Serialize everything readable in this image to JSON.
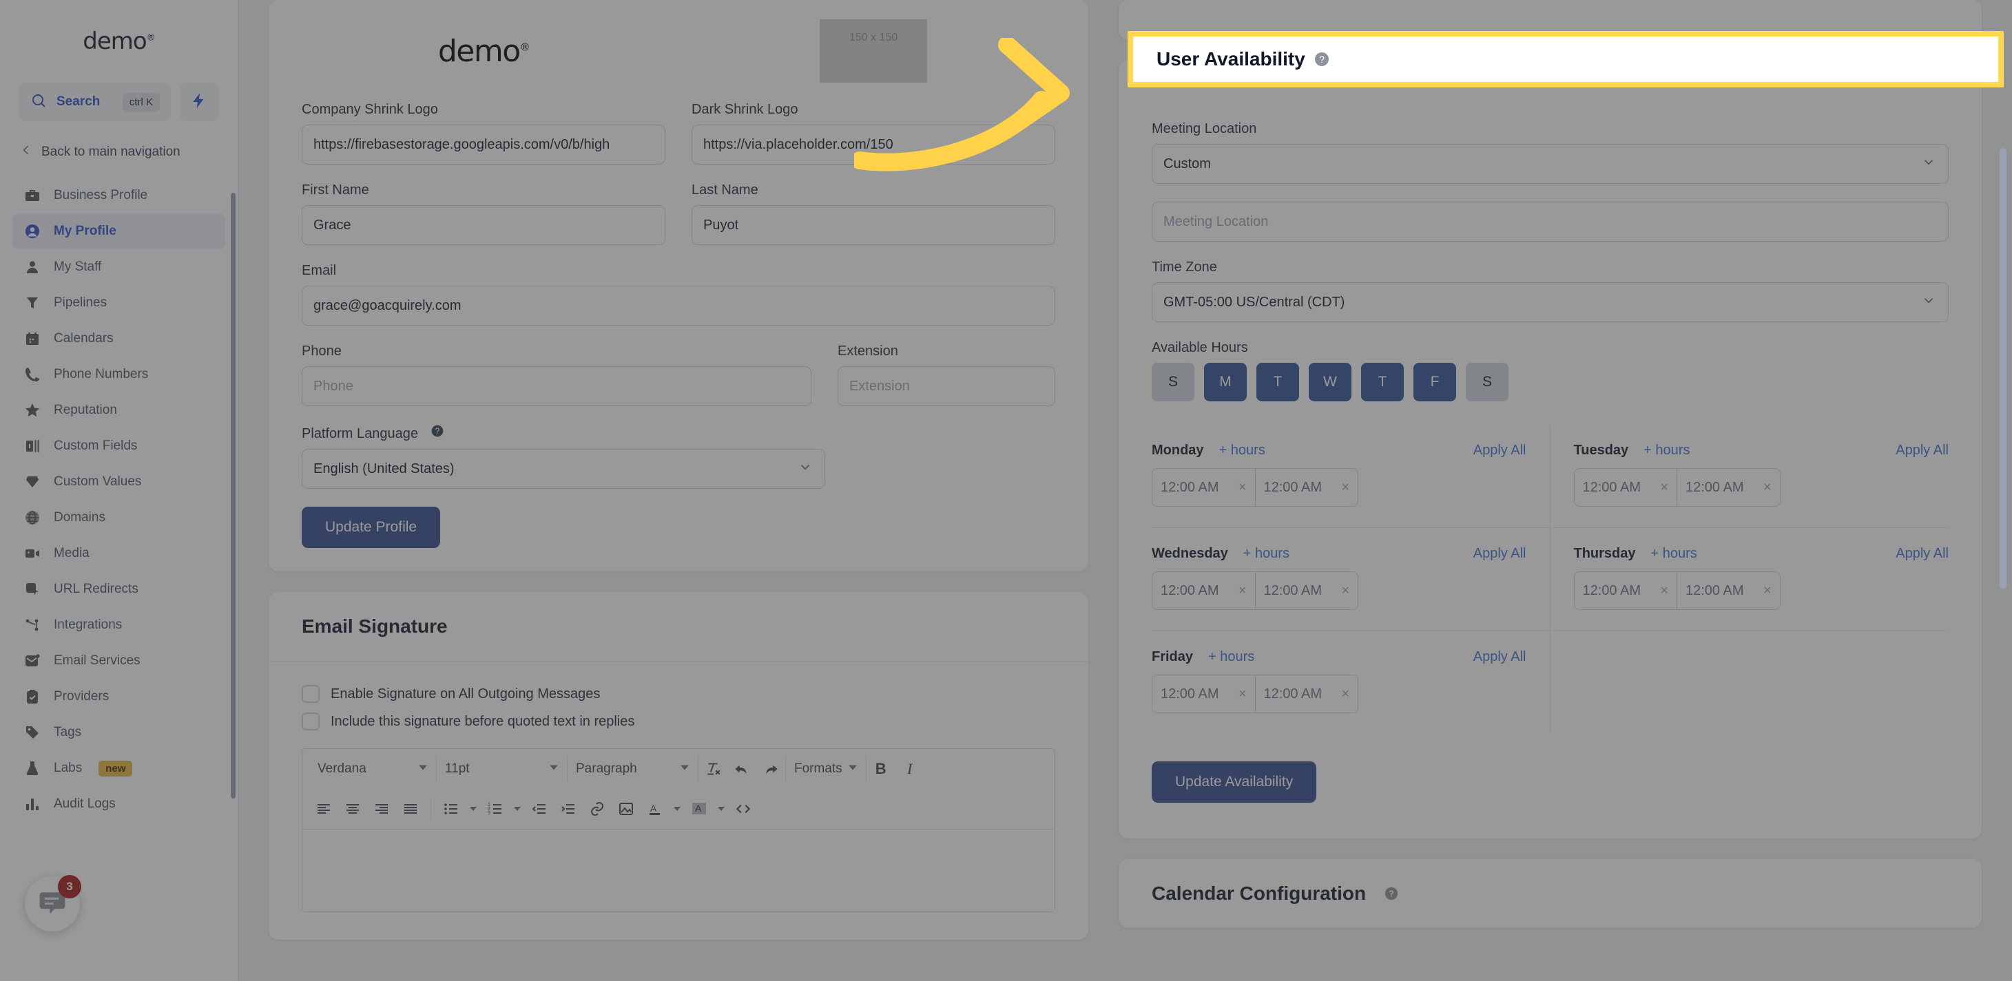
{
  "brand": {
    "name": "demo",
    "mark": "®"
  },
  "search": {
    "label": "Search",
    "shortcut": "ctrl K"
  },
  "back_nav": {
    "label": "Back to main navigation"
  },
  "sidebar": {
    "items": [
      {
        "label": "Business Profile",
        "icon": "briefcase-icon",
        "active": false
      },
      {
        "label": "My Profile",
        "icon": "user-circle-icon",
        "active": true
      },
      {
        "label": "My Staff",
        "icon": "person-icon",
        "active": false
      },
      {
        "label": "Pipelines",
        "icon": "funnel-icon",
        "active": false
      },
      {
        "label": "Calendars",
        "icon": "calendar-icon",
        "active": false
      },
      {
        "label": "Phone Numbers",
        "icon": "phone-icon",
        "active": false
      },
      {
        "label": "Reputation",
        "icon": "star-icon",
        "active": false
      },
      {
        "label": "Custom Fields",
        "icon": "fields-icon",
        "active": false
      },
      {
        "label": "Custom Values",
        "icon": "gem-icon",
        "active": false
      },
      {
        "label": "Domains",
        "icon": "globe-icon",
        "active": false
      },
      {
        "label": "Media",
        "icon": "video-icon",
        "active": false
      },
      {
        "label": "URL Redirects",
        "icon": "cursor-square-icon",
        "active": false
      },
      {
        "label": "Integrations",
        "icon": "nodes-icon",
        "active": false
      },
      {
        "label": "Email Services",
        "icon": "mail-icon",
        "active": false
      },
      {
        "label": "Providers",
        "icon": "clipboard-check-icon",
        "active": false
      },
      {
        "label": "Tags",
        "icon": "tag-icon",
        "active": false
      },
      {
        "label": "Labs",
        "icon": "flask-icon",
        "active": false,
        "badge": "new"
      },
      {
        "label": "Audit Logs",
        "icon": "bar-chart-icon",
        "active": false
      }
    ]
  },
  "chat_widget": {
    "count": "3"
  },
  "profile": {
    "company_shrink_logo": {
      "label": "Company Shrink Logo",
      "value": "https://firebasestorage.googleapis.com/v0/b/high"
    },
    "dark_shrink_logo": {
      "label": "Dark Shrink Logo",
      "value": "https://via.placeholder.com/150"
    },
    "dark_logo_placeholder": "150 x 150",
    "first_name": {
      "label": "First Name",
      "value": "Grace"
    },
    "last_name": {
      "label": "Last Name",
      "value": "Puyot"
    },
    "email": {
      "label": "Email",
      "value": "grace@goacquirely.com"
    },
    "phone": {
      "label": "Phone",
      "placeholder": "Phone",
      "value": ""
    },
    "extension": {
      "label": "Extension",
      "placeholder": "Extension",
      "value": ""
    },
    "platform_language": {
      "label": "Platform Language",
      "value": "English (United States)"
    },
    "update_button": "Update Profile"
  },
  "email_signature": {
    "title": "Email Signature",
    "checkboxes": [
      {
        "label": "Enable Signature on All Outgoing Messages",
        "checked": false
      },
      {
        "label": "Include this signature before quoted text in replies",
        "checked": false
      }
    ],
    "toolbar": {
      "font_family": "Verdana",
      "font_size": "11pt",
      "block_format": "Paragraph",
      "formats": "Formats",
      "bold": "B",
      "italic": "I"
    }
  },
  "availability": {
    "title": "User Availability",
    "meeting_location": {
      "label": "Meeting Location",
      "value": "Custom"
    },
    "meeting_location_input": {
      "placeholder": "Meeting Location",
      "value": ""
    },
    "time_zone": {
      "label": "Time Zone",
      "value": "GMT-05:00 US/Central (CDT)"
    },
    "available_hours_label": "Available Hours",
    "day_toggles": [
      {
        "letter": "S",
        "name": "Sunday",
        "on": false
      },
      {
        "letter": "M",
        "name": "Monday",
        "on": true
      },
      {
        "letter": "T",
        "name": "Tuesday",
        "on": true
      },
      {
        "letter": "W",
        "name": "Wednesday",
        "on": true
      },
      {
        "letter": "T",
        "name": "Thursday",
        "on": true
      },
      {
        "letter": "F",
        "name": "Friday",
        "on": true
      },
      {
        "letter": "S",
        "name": "Saturday",
        "on": false
      }
    ],
    "add_hours_label": "+ hours",
    "apply_all_label": "Apply All",
    "days": [
      {
        "name": "Monday",
        "start": "12:00 AM",
        "end": "12:00 AM"
      },
      {
        "name": "Tuesday",
        "start": "12:00 AM",
        "end": "12:00 AM"
      },
      {
        "name": "Wednesday",
        "start": "12:00 AM",
        "end": "12:00 AM"
      },
      {
        "name": "Thursday",
        "start": "12:00 AM",
        "end": "12:00 AM"
      },
      {
        "name": "Friday",
        "start": "12:00 AM",
        "end": "12:00 AM"
      }
    ],
    "update_button": "Update Availability"
  },
  "calendar_configuration": {
    "title": "Calendar Configuration"
  },
  "colors": {
    "accent_blue": "#2f4fcd",
    "primary_button": "#2f4a8f",
    "day_on": "#2d5196",
    "day_off": "#d0d5dd",
    "link": "#3b6fd4",
    "highlight_yellow": "#ffd84d",
    "badge_new": "#e5b53c",
    "chat_badge_red": "#a31515"
  }
}
